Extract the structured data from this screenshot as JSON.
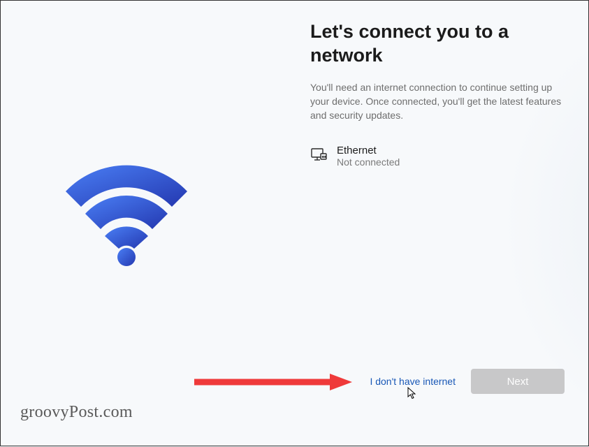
{
  "page": {
    "title": "Let's connect you to a network",
    "subtitle": "You'll need an internet connection to continue setting up your device. Once connected, you'll get the latest features and security updates."
  },
  "network": {
    "name": "Ethernet",
    "status": "Not connected"
  },
  "actions": {
    "skip_label": "I don't have internet",
    "next_label": "Next"
  },
  "watermark": "groovyPost.com",
  "colors": {
    "wifi_gradient_start": "#3a6ff0",
    "wifi_gradient_end": "#2b3fb8",
    "link": "#1857b6",
    "arrow": "#ef3a3a"
  }
}
